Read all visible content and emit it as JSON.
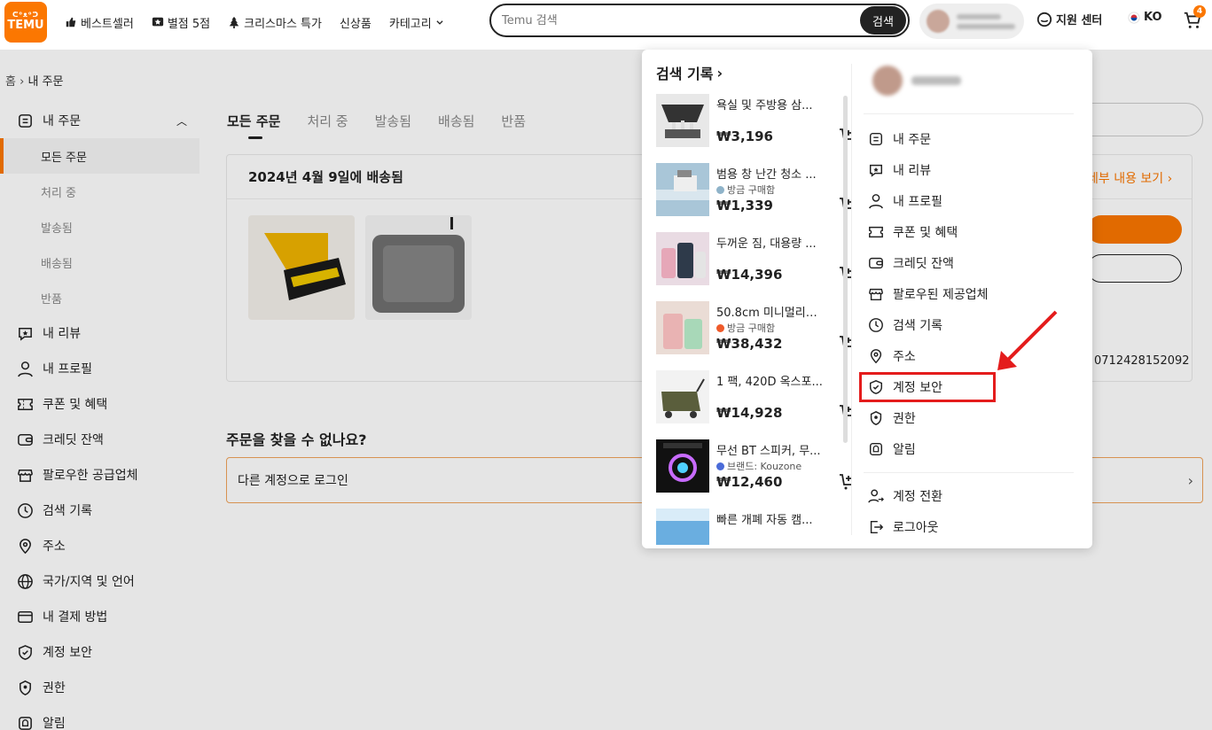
{
  "header": {
    "logo_top": "ᕦ⁰ᴥ⁰ᕤ",
    "logo_text": "TEMU",
    "nav": [
      {
        "label": "베스트셀러",
        "icon": "thumbs-up-icon"
      },
      {
        "label": "별점 5점",
        "icon": "star-badge-icon"
      },
      {
        "label": "크리스마스 특가",
        "icon": "tree-icon"
      },
      {
        "label": "신상품",
        "icon": ""
      },
      {
        "label": "카테고리",
        "icon": "chevron-down-icon"
      }
    ],
    "search_placeholder": "Temu 검색",
    "search_button": "검색",
    "support": "지원 센터",
    "lang": "KO",
    "cart_count": "4"
  },
  "breadcrumb": {
    "home": "홈",
    "sep": "›",
    "current": "내 주문"
  },
  "sidebar": {
    "orders_label": "내 주문",
    "sub": [
      "모든 주문",
      "처리 중",
      "발송됨",
      "배송됨",
      "반품"
    ],
    "items": [
      {
        "label": "내 리뷰",
        "icon": "review-icon"
      },
      {
        "label": "내 프로필",
        "icon": "person-icon"
      },
      {
        "label": "쿠폰 및 혜택",
        "icon": "coupon-icon"
      },
      {
        "label": "크레딧 잔액",
        "icon": "wallet-icon"
      },
      {
        "label": "팔로우한 공급업체",
        "icon": "store-icon"
      },
      {
        "label": "검색 기록",
        "icon": "clock-icon"
      },
      {
        "label": "주소",
        "icon": "location-icon"
      },
      {
        "label": "국가/지역 및 언어",
        "icon": "globe-icon"
      },
      {
        "label": "내 결제 방법",
        "icon": "card-icon"
      },
      {
        "label": "계정 보안",
        "icon": "shield-icon"
      },
      {
        "label": "권한",
        "icon": "permission-icon"
      },
      {
        "label": "알림",
        "icon": "bell-icon"
      }
    ]
  },
  "tabs": [
    "모든 주문",
    "처리 중",
    "발송됨",
    "배송됨",
    "반품"
  ],
  "order": {
    "title": "2024년 4월 9일에 배송됨",
    "detail": "세부 내용 보기 ›",
    "order_id": "0712428152092"
  },
  "notfound": {
    "title": "주문을 찾을 수 없나요?",
    "login_other": "다른 계정으로 로그인"
  },
  "popup": {
    "history_title": "검색 기록",
    "products": [
      {
        "name": "욕실 및 주방용 삼...",
        "tag": "",
        "price": "₩3,196"
      },
      {
        "name": "범용 창 난간 청소 ...",
        "tag": "방금 구매함",
        "price": "₩1,339"
      },
      {
        "name": "두꺼운 짐, 대용량 ...",
        "tag": "",
        "price": "₩14,396"
      },
      {
        "name": "50.8cm 미니멀리스...",
        "tag": "방금 구매함",
        "price": "₩38,432"
      },
      {
        "name": "1 팩, 420D 옥스포...",
        "tag": "",
        "price": "₩14,928"
      },
      {
        "name": "무선 BT 스피커, 무...",
        "tag": "브랜드: Kouzone",
        "price": "₩12,460"
      },
      {
        "name": "빠른 개폐 자동 캠...",
        "tag": "",
        "price": ""
      }
    ],
    "menu": [
      {
        "label": "내 주문",
        "icon": "orders-icon"
      },
      {
        "label": "내 리뷰",
        "icon": "review-icon"
      },
      {
        "label": "내 프로필",
        "icon": "person-icon"
      },
      {
        "label": "쿠폰 및 혜택",
        "icon": "coupon-icon"
      },
      {
        "label": "크레딧 잔액",
        "icon": "wallet-icon"
      },
      {
        "label": "팔로우된 제공업체",
        "icon": "store-icon"
      },
      {
        "label": "검색 기록",
        "icon": "clock-icon"
      },
      {
        "label": "주소",
        "icon": "location-icon"
      },
      {
        "label": "계정 보안",
        "icon": "shield-icon"
      },
      {
        "label": "권한",
        "icon": "permission-icon"
      },
      {
        "label": "알림",
        "icon": "bell-icon"
      }
    ],
    "switch_account": "계정 전환",
    "logout": "로그아웃"
  },
  "colors": {
    "brand": "#fb7701",
    "highlight": "#e41c1c"
  }
}
